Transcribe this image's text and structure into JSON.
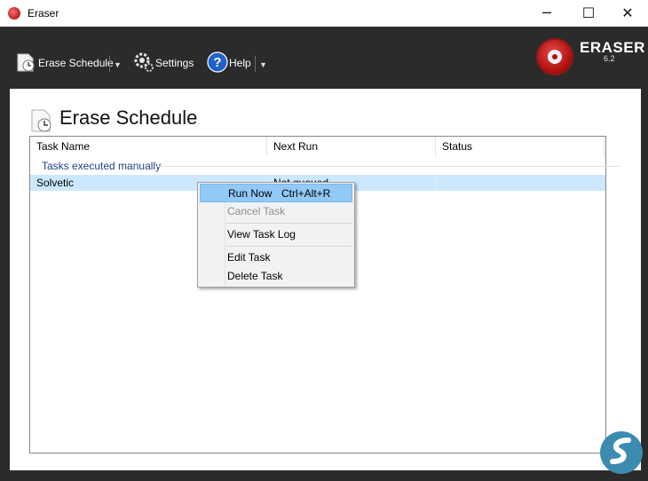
{
  "window": {
    "title": "Eraser",
    "minimize": "─",
    "maximize": "☐",
    "close": "✕"
  },
  "toolbar": {
    "erase_schedule": "Erase Schedule",
    "settings": "Settings",
    "help": "Help",
    "dropdown_glyph": "▼"
  },
  "logo": {
    "name": "ERASER",
    "version": "6.2"
  },
  "page": {
    "heading": "Erase Schedule"
  },
  "table": {
    "columns": [
      "Task Name",
      "Next Run",
      "Status"
    ],
    "group": "Tasks executed manually",
    "rows": [
      {
        "task_name": "Solvetic",
        "next_run": "Not queued",
        "status": ""
      }
    ]
  },
  "context_menu": {
    "items": [
      {
        "label": "Run Now",
        "shortcut": "Ctrl+Alt+R",
        "state": "highlighted"
      },
      {
        "label": "Cancel Task",
        "shortcut": "",
        "state": "disabled"
      },
      {
        "label": "View Task Log",
        "shortcut": "",
        "state": "normal"
      },
      {
        "label": "Edit Task",
        "shortcut": "",
        "state": "normal"
      },
      {
        "label": "Delete Task",
        "shortcut": "",
        "state": "normal"
      }
    ]
  },
  "colors": {
    "toolbar_bg": "#2b2b2b",
    "selection": "#cce8ff",
    "menu_highlight": "#91c9f7",
    "group_text": "#1e3f8c"
  }
}
